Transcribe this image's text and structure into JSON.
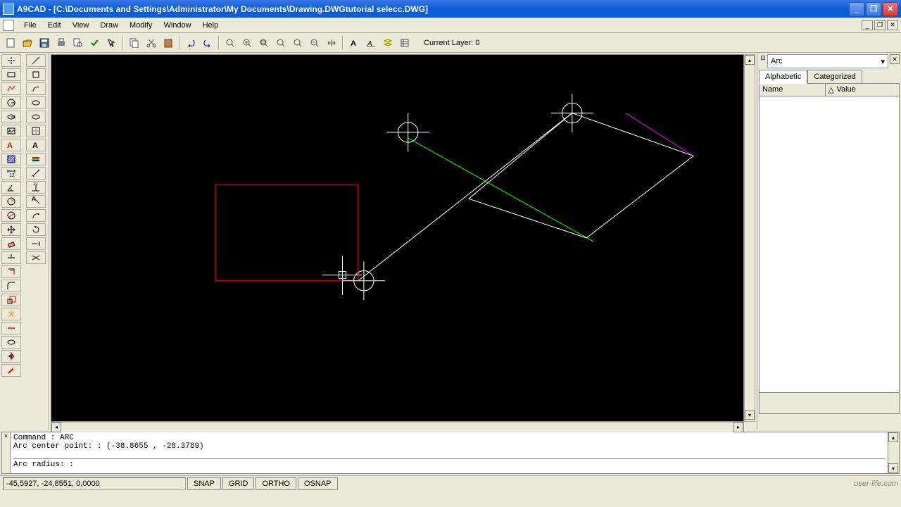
{
  "title": "A9CAD - [C:\\Documents and Settings\\Administrator\\My Documents\\Drawing.DWGtutorial selecc.DWG]",
  "menu": {
    "file": "File",
    "edit": "Edit",
    "view": "View",
    "draw": "Draw",
    "modify": "Modify",
    "window": "Window",
    "help": "Help"
  },
  "toolbar": {
    "layer_label": "Current Layer: 0"
  },
  "properties": {
    "object_type": "Arc",
    "tab_alpha": "Alphabetic",
    "tab_cat": "Categorized",
    "col_name": "Name",
    "col_value": "Value"
  },
  "command": {
    "line1": "Command : ARC",
    "line2": "Arc center point: : (-38.8655 , -28.3789)",
    "prompt": "Arc radius: :"
  },
  "status": {
    "coords": "-45,5927, -24,8551, 0,0000",
    "snap": "SNAP",
    "grid": "GRID",
    "ortho": "ORTHO",
    "osnap": "OSNAP",
    "watermark": "user-life.com"
  },
  "icons": {
    "new": "□",
    "open": "📂",
    "save": "💾",
    "print": "🖶",
    "preview": "🔍",
    "undo": "↶",
    "redo": "↷",
    "cut": "✂",
    "copy": "⎘",
    "paste": "📋",
    "zoomin": "+",
    "zoomout": "-",
    "zoomall": "⊡",
    "pan": "✋"
  }
}
